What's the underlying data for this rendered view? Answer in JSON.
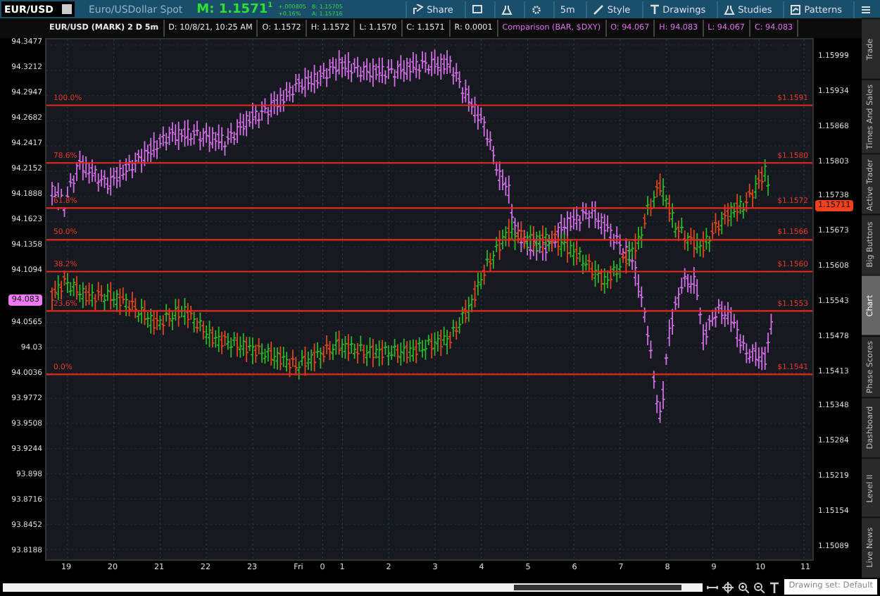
{
  "symbol": {
    "ticker": "EUR/USD",
    "description": "Euro/USDollar Spot",
    "mark": "M: 1.1571$^{1}$",
    "change": "+.000805",
    "change_pct": "+0.16%",
    "bid": "B: 1.15705",
    "ask": "A: 1.15716"
  },
  "toolbar": [
    {
      "kind": "share",
      "label": "Share"
    },
    {
      "kind": "screen"
    },
    {
      "kind": "flask"
    },
    {
      "kind": "gear"
    },
    {
      "kind": "text",
      "label": "5m"
    },
    {
      "kind": "style",
      "label": "Style"
    },
    {
      "kind": "drawings",
      "label": "Drawings"
    },
    {
      "kind": "studies",
      "label": "Studies"
    },
    {
      "kind": "patterns",
      "label": "Patterns"
    },
    {
      "kind": "menu"
    }
  ],
  "info": {
    "title": "EUR/USD (MARK) 2 D 5m",
    "fields": [
      "D: 10/8/21, 10:25 AM",
      "O: 1.1572",
      "H: 1.1572",
      "L: 1.1570",
      "C: 1.1571",
      "R: 0.0001"
    ],
    "comparison": "Comparison (BAR, $DXY)",
    "comparison_fields": [
      "O: 94.067",
      "H: 94.083",
      "L: 94.067",
      "C: 94.083"
    ]
  },
  "left_axis": {
    "ticks": [
      "94.3477",
      "94.3212",
      "94.2947",
      "94.2682",
      "94.2417",
      "94.2152",
      "94.1888",
      "94.1623",
      "94.1358",
      "94.1094",
      "94.0565",
      "94.03",
      "94.0036",
      "93.9772",
      "93.9508",
      "93.9244",
      "93.898",
      "93.8716",
      "93.8452",
      "93.8188"
    ],
    "current": "94.083"
  },
  "right_axis": {
    "ticks": [
      "1.15999",
      "1.15934",
      "1.15868",
      "1.15803",
      "1.15738",
      "1.15673",
      "1.15608",
      "1.15543",
      "1.15478",
      "1.15413",
      "1.15348",
      "1.15284",
      "1.15219",
      "1.15154",
      "1.15089"
    ],
    "current": "1.15711"
  },
  "fib_levels": [
    {
      "label": "100.0%",
      "price": "$1.1591"
    },
    {
      "label": "78.6%",
      "price": "$1.1580"
    },
    {
      "label": "61.8%",
      "price": "$1.1572"
    },
    {
      "label": "50.0%",
      "price": "$1.1566"
    },
    {
      "label": "38.2%",
      "price": "$1.1560"
    },
    {
      "label": "23.6%",
      "price": "$1.1553"
    },
    {
      "label": "0.0%",
      "price": "$1.1541"
    }
  ],
  "x_axis": [
    "19",
    "20",
    "21",
    "22",
    "23",
    "Fri",
    "0",
    "1",
    "2",
    "3",
    "4",
    "5",
    "6",
    "7",
    "8",
    "9",
    "10",
    "11"
  ],
  "side_tabs": [
    {
      "label": "Trade",
      "selected": false
    },
    {
      "label": "Times And Sales",
      "selected": false
    },
    {
      "label": "Active Trader",
      "selected": false
    },
    {
      "label": "Big Buttons",
      "selected": false
    },
    {
      "label": "Chart",
      "selected": true
    },
    {
      "label": "Phase Scores",
      "selected": false
    },
    {
      "label": "Dashboard",
      "selected": false
    },
    {
      "label": "Level II",
      "selected": false
    },
    {
      "label": "Live News",
      "selected": false
    }
  ],
  "drawing_set": "Drawing set: Default"
}
